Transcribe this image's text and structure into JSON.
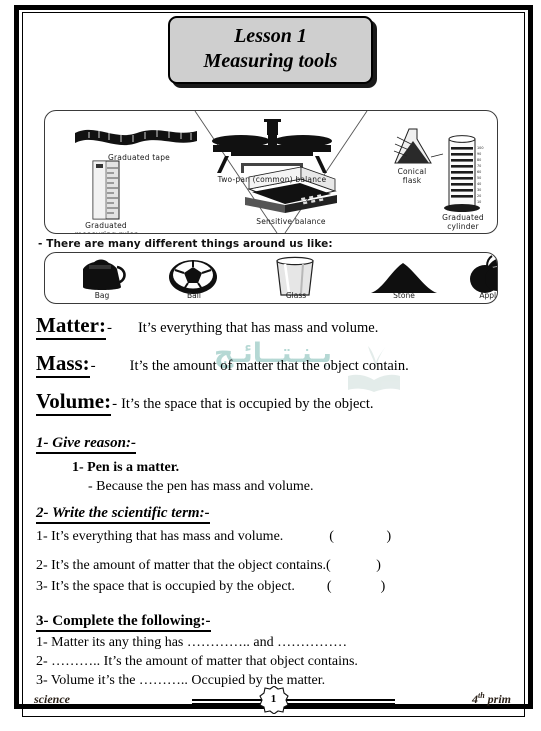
{
  "lesson": {
    "title_line1": "Lesson 1",
    "title_line2": "Measuring tools"
  },
  "tools_panel": {
    "items": [
      {
        "name": "Graduated tape",
        "icon": "measuring-tape-icon"
      },
      {
        "name": "Graduated measuring ruler",
        "line1": "Graduated",
        "line2": "measuring ruler",
        "icon": "ruler-icon"
      },
      {
        "name": "Two-pan (common) balance",
        "icon": "two-pan-balance-icon"
      },
      {
        "name": "Sensitive balance",
        "icon": "digital-balance-icon"
      },
      {
        "name": "Conical flask",
        "line1": "Conical",
        "line2": "flask",
        "icon": "conical-flask-icon"
      },
      {
        "name": "Graduated cylinder",
        "line1": "Graduated",
        "line2": "cylinder",
        "icon": "graduated-cylinder-icon"
      }
    ]
  },
  "things_section": {
    "lead": "- There are many different things around us like:",
    "items": [
      {
        "label": "Bag",
        "icon": "bag-icon"
      },
      {
        "label": "Ball",
        "icon": "ball-icon"
      },
      {
        "label": "Glass",
        "icon": "glass-icon"
      },
      {
        "label": "Stone",
        "icon": "stone-icon"
      },
      {
        "label": "Apple",
        "icon": "apple-icon"
      }
    ]
  },
  "watermark": {
    "text": "يـنـتــائـج"
  },
  "definitions": [
    {
      "term": "Matter:",
      "dash": "-",
      "text": "It’s everything that has mass and volume."
    },
    {
      "term": "Mass:",
      "dash": "-",
      "text": "It’s the amount of matter that the object contain."
    },
    {
      "term": "Volume:",
      "dash": "-",
      "text": "It’s the space that is occupied by the object."
    }
  ],
  "exercises": {
    "give_reason": {
      "heading": "1- Give reason:-",
      "question": "1- Pen is a matter.",
      "answer": "-    Because the pen has mass and volume."
    },
    "scientific_term": {
      "heading": "2- Write the scientific term:-",
      "items": [
        {
          "text": "1- It’s everything that has mass and volume.",
          "blank": "(               )"
        },
        {
          "text": "2- It’s the amount of matter that the object contains.",
          "blank": "(             )"
        },
        {
          "text": "3- It’s the space that is occupied by the object.",
          "blank": "(              )"
        }
      ]
    },
    "complete": {
      "heading": "3- Complete the following:-",
      "items": [
        "1- Matter its any thing has ………….. and ……………",
        "2- ……….. It’s the amount of matter that object contains.",
        "3- Volume it’s the ……….. Occupied by the matter."
      ]
    }
  },
  "footer": {
    "subject": "science",
    "grade_number": "4",
    "grade_suffix": "th",
    "grade_word": "prim",
    "page_number": "1"
  }
}
